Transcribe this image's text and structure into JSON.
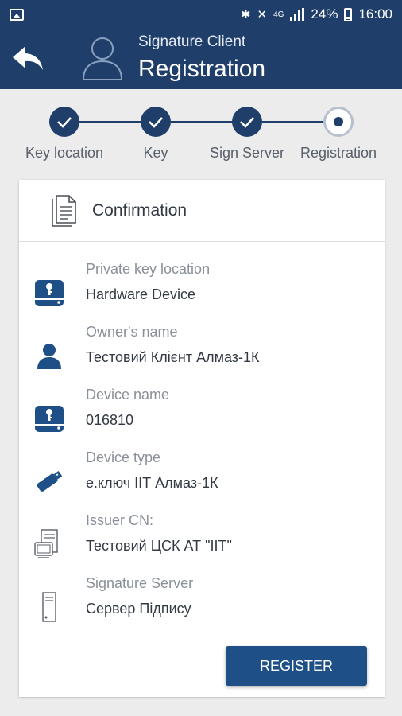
{
  "status_bar": {
    "battery": "24%",
    "time": "16:00",
    "network": "4G"
  },
  "header": {
    "subtitle": "Signature Client",
    "title": "Registration"
  },
  "stepper": {
    "steps": [
      {
        "label": "Key location",
        "state": "done"
      },
      {
        "label": "Key",
        "state": "done"
      },
      {
        "label": "Sign Server",
        "state": "done"
      },
      {
        "label": "Registration",
        "state": "current"
      }
    ]
  },
  "card": {
    "title": "Confirmation",
    "rows": [
      {
        "label": "Private key location",
        "value": "Hardware Device",
        "icon": "hard-drive-key-icon"
      },
      {
        "label": "Owner's name",
        "value": "Тестовий Клієнт Алмаз-1К",
        "icon": "person-icon"
      },
      {
        "label": "Device name",
        "value": "016810",
        "icon": "hard-drive-key-icon"
      },
      {
        "label": "Device type",
        "value": "е.ключ ІІТ Алмаз-1К",
        "icon": "usb-key-icon"
      },
      {
        "label": "Issuer CN:",
        "value": "Тестовий ЦСК АТ \"ІІТ\"",
        "icon": "issuer-server-icon"
      },
      {
        "label": "Signature Server",
        "value": "Сервер Підпису",
        "icon": "server-tower-icon"
      }
    ],
    "register_label": "REGISTER"
  },
  "colors": {
    "primary": "#1f3e69",
    "button": "#1f4f87",
    "background": "#ececec"
  }
}
